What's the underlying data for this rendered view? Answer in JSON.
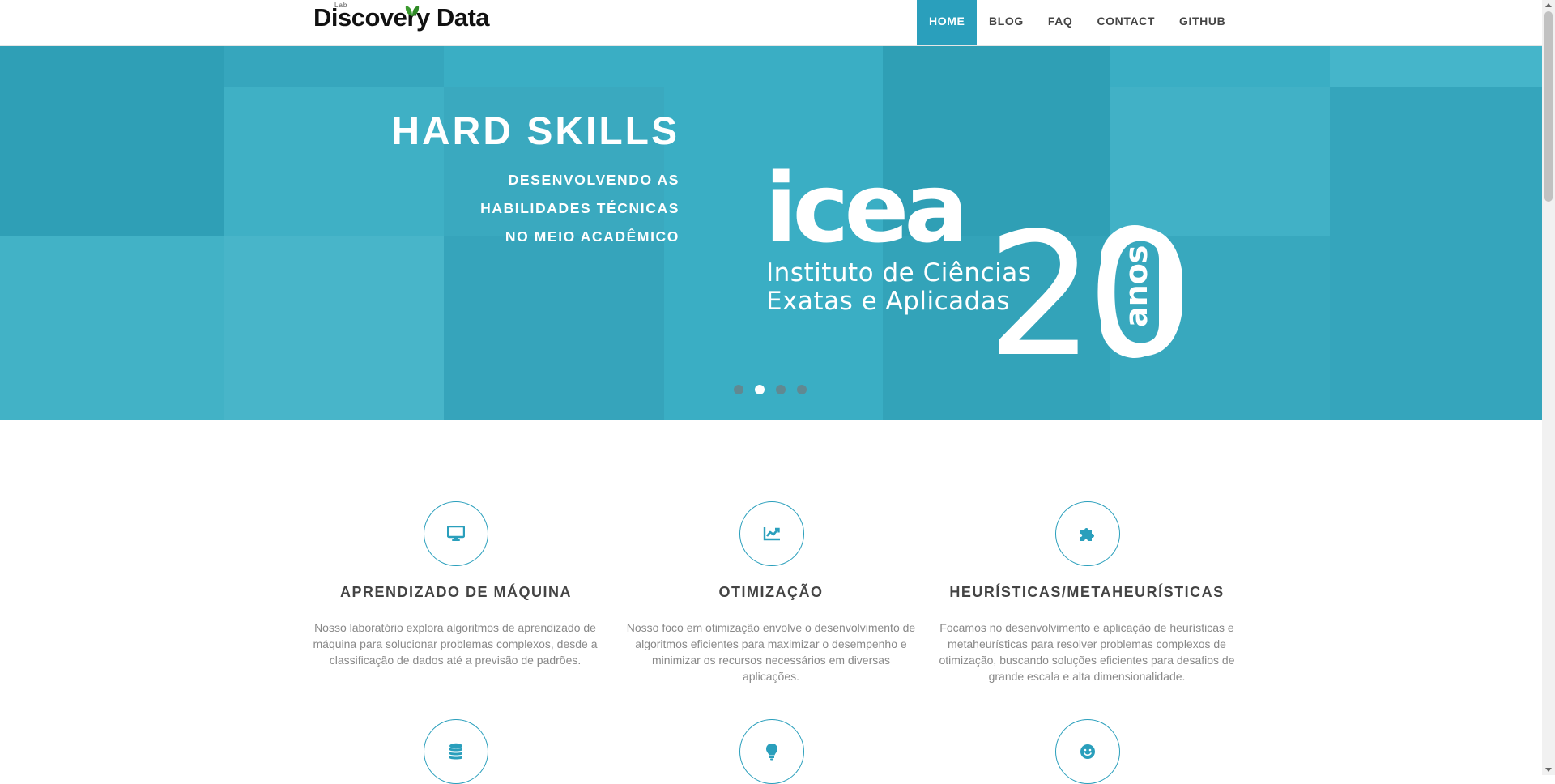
{
  "brand": {
    "small": "Lab",
    "name": "Discovery Data",
    "leaf_color": "#3b9b2f"
  },
  "nav": {
    "items": [
      {
        "label": "HOME",
        "active": true
      },
      {
        "label": "BLOG"
      },
      {
        "label": "FAQ"
      },
      {
        "label": "CONTACT"
      },
      {
        "label": "GITHUB"
      }
    ]
  },
  "colors": {
    "accent": "#2a9fbc",
    "hero_bg": "#3aaec4"
  },
  "hero": {
    "title": "HARD SKILLS",
    "subtitle_lines": [
      "DESENVOLVENDO AS",
      "HABILIDADES TÉCNICAS",
      "NO MEIO ACADÊMICO"
    ],
    "logo": {
      "word": "icea",
      "number": "20",
      "anos": "anos",
      "line1": "Instituto de Ciências",
      "line2": "Exatas e Aplicadas"
    },
    "carousel_active_index": 1,
    "carousel_count": 4
  },
  "services": [
    {
      "icon": "monitor-icon",
      "title": "APRENDIZADO DE MÁQUINA",
      "text": "Nosso laboratório explora algoritmos de aprendizado de máquina para solucionar problemas complexos, desde a classificação de dados até a previsão de padrões."
    },
    {
      "icon": "line-chart-icon",
      "title": "OTIMIZAÇÃO",
      "text": "Nosso foco em otimização envolve o desenvolvimento de algoritmos eficientes para maximizar o desempenho e minimizar os recursos necessários em diversas aplicações."
    },
    {
      "icon": "puzzle-icon",
      "title": "HEURÍSTICAS/METAHEURÍSTICAS",
      "text": "Focamos no desenvolvimento e aplicação de heurísticas e metaheurísticas para resolver problemas complexos de otimização, buscando soluções eficientes para desafios de grande escala e alta dimensionalidade."
    }
  ],
  "services_row2_icons": [
    "database-icon",
    "lightbulb-icon",
    "smile-icon"
  ]
}
